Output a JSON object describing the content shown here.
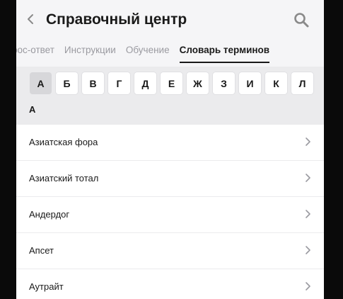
{
  "header": {
    "title": "Справочный центр",
    "back_icon": "chevron-left-icon",
    "search_icon": "search-icon"
  },
  "tabs": [
    {
      "label": "рос-ответ",
      "active": false
    },
    {
      "label": "Инструкции",
      "active": false
    },
    {
      "label": "Обучение",
      "active": false
    },
    {
      "label": "Словарь терминов",
      "active": true
    }
  ],
  "letters": [
    "А",
    "Б",
    "В",
    "Г",
    "Д",
    "Е",
    "Ж",
    "З",
    "И",
    "К",
    "Л"
  ],
  "selected_letter": "А",
  "section": {
    "title": "А"
  },
  "terms": [
    {
      "label": "Азиатская фора"
    },
    {
      "label": "Азиатский тотал"
    },
    {
      "label": "Андердог"
    },
    {
      "label": "Апсет"
    },
    {
      "label": "Аутрайт"
    }
  ],
  "colors": {
    "background": "#f5f5f7",
    "text": "#1a1a1a",
    "muted": "#9a9aa0",
    "icon": "#8a8a8a"
  }
}
